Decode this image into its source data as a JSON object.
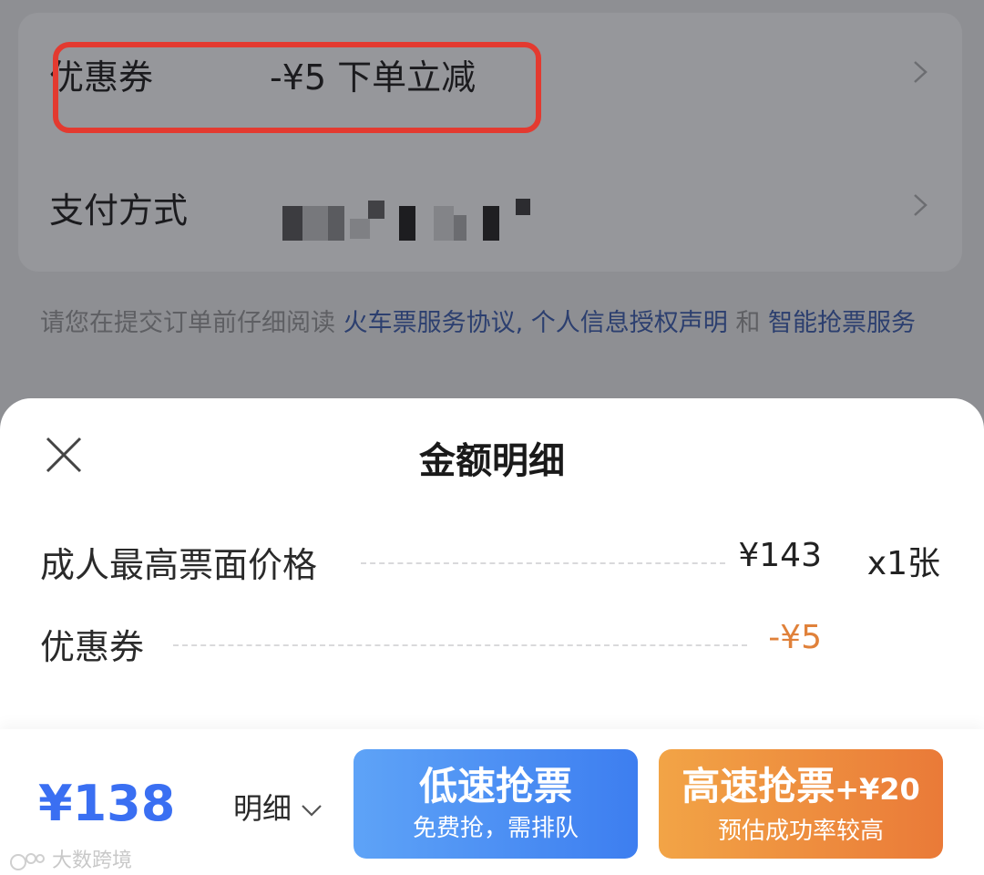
{
  "background": {
    "coupon_row": {
      "label": "优惠券",
      "value": "-¥5 下单立减"
    },
    "payment_row": {
      "label": "支付方式"
    },
    "agreement": {
      "prefix": "请您在提交订单前仔细阅读 ",
      "link1": "火车票服务协议,",
      "space": " ",
      "link2": "个人信息授权声明",
      "conj": " 和 ",
      "link3": "智能抢票服务"
    }
  },
  "sheet": {
    "title": "金额明细",
    "rows": [
      {
        "label": "成人最高票面价格",
        "amount": "¥143",
        "qty": "x1张"
      },
      {
        "label": "优惠券",
        "amount": "-¥5"
      }
    ]
  },
  "footer": {
    "total": "¥138",
    "detail_label": "明细",
    "low_speed": {
      "title": "低速抢票",
      "subtitle": "免费抢，需排队"
    },
    "high_speed": {
      "title": "高速抢票",
      "extra": "+¥20",
      "subtitle": "预估成功率较高"
    }
  },
  "watermark": "大数跨境",
  "colors": {
    "highlight": "#e33a30",
    "price_blue": "#3a6ff2",
    "discount_orange": "#e0813a"
  }
}
